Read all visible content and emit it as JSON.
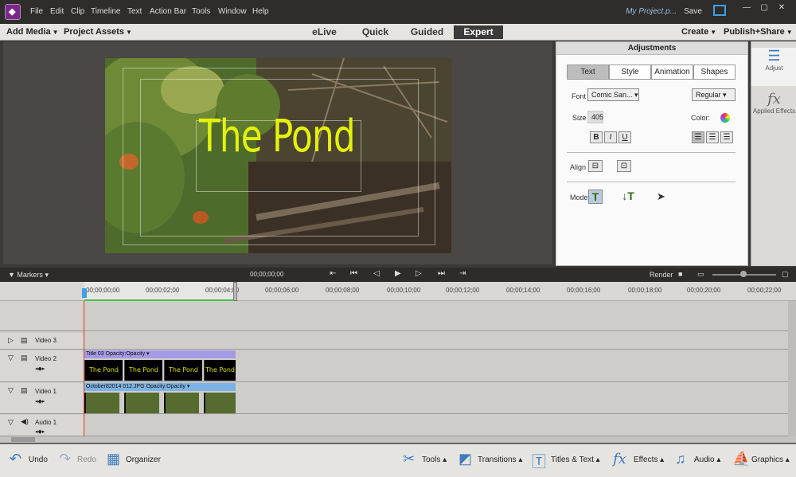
{
  "menu": {
    "items": [
      "File",
      "Edit",
      "Clip",
      "Timeline",
      "Text",
      "Action Bar",
      "Tools",
      "Window",
      "Help"
    ],
    "project_name": "My Project.p...",
    "save_label": "Save"
  },
  "topbar": {
    "add_media": "Add Media",
    "project_assets": "Project Assets",
    "modes": [
      "eLive",
      "Quick",
      "Guided",
      "Expert"
    ],
    "active_mode": "Expert",
    "create": "Create",
    "publish_share": "Publish+Share"
  },
  "preview": {
    "title_text": "The Pond"
  },
  "adjustments": {
    "header": "Adjustments",
    "tabs": [
      "Text",
      "Style",
      "Animation",
      "Shapes"
    ],
    "active_tab": "Text",
    "font_label": "Font",
    "font_value": "Comic San...",
    "style_value": "Regular",
    "size_label": "Size",
    "size_value": "405",
    "color_label": "Color:",
    "bold": "B",
    "italic": "I",
    "underline": "U",
    "align_label": "Align",
    "mode_label": "Mode"
  },
  "right_sidebar": {
    "adjust_label": "Adjust",
    "applied_effects_label": "Applied Effects"
  },
  "transport": {
    "markers_label": "Markers",
    "timecode": "00;00;00;00",
    "render_label": "Render"
  },
  "ruler": {
    "ticks": [
      "00;00;00;00",
      "00;00;02;00",
      "00;00;04;00",
      "00;00;06;00",
      "00;00;08;00",
      "00;00;10;00",
      "00;00;12;00",
      "00;00;14;00",
      "00;00;16;00",
      "00;00;18;00",
      "00;00;20;00",
      "00;00;22;00"
    ]
  },
  "tracks": {
    "video3": "Video 3",
    "video2": "Video 2",
    "video1": "Video 1",
    "audio1": "Audio 1",
    "title_clip_name": "Title 03",
    "title_clip_opacity": "Opacity:Opacity",
    "photo_clip_name": "October82014 012.JPG",
    "photo_clip_opacity": "Opacity:Opacity",
    "title_frame_text": "The Pond"
  },
  "bottombar": {
    "undo": "Undo",
    "redo": "Redo",
    "organizer": "Organizer",
    "tools": "Tools",
    "transitions": "Transitions",
    "titles_text": "Titles & Text",
    "effects": "Effects",
    "audio": "Audio",
    "graphics": "Graphics"
  },
  "colors": {
    "title_text": "#e4f20b",
    "accent_blue": "#3fa0e6",
    "playhead": "#d43a2a"
  }
}
